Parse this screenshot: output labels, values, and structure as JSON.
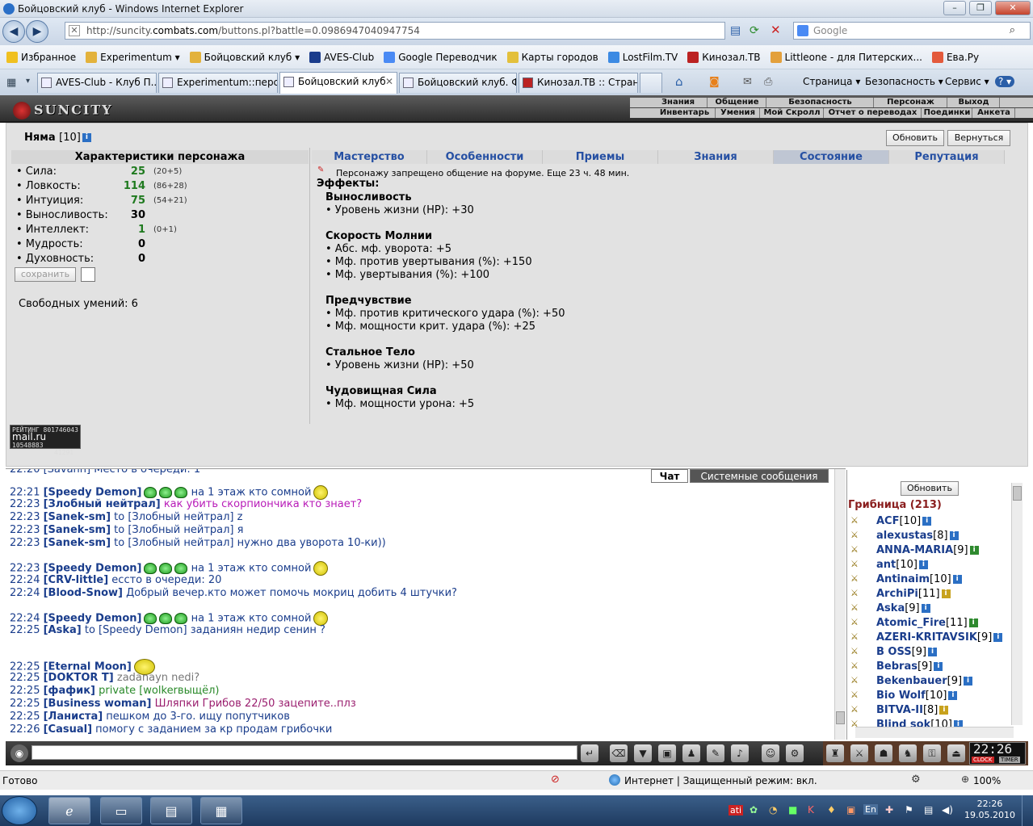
{
  "window": {
    "title": "Бойцовский клуб - Windows Internet Explorer",
    "min": "–",
    "max": "❐",
    "close": "✕"
  },
  "address": {
    "url_pre": "http://suncity.",
    "url_host": "combats.com",
    "url_post": "/buttons.pl?battle=0.0986947040947754",
    "search_placeholder": "Google"
  },
  "favorites": {
    "label": "Избранное",
    "items": [
      {
        "label": "Experimentum ▾",
        "color": "#e3b23c"
      },
      {
        "label": "Бойцовский клуб ▾",
        "color": "#e3b23c"
      },
      {
        "label": "AVES-Club",
        "color": "#1b3d8c"
      },
      {
        "label": "Google Переводчик",
        "color": "#4a8af4"
      },
      {
        "label": "Карты городов",
        "color": "#e3c03c"
      },
      {
        "label": "LostFilm.TV",
        "color": "#3c8ae3"
      },
      {
        "label": "Кинозал.ТВ",
        "color": "#b22"
      },
      {
        "label": "Littleone - для Питерских...",
        "color": "#e3a03c"
      },
      {
        "label": "Ева.Ру",
        "color": "#e35a3c"
      }
    ]
  },
  "tabs": [
    {
      "label": "AVES-Club - Клуб П..."
    },
    {
      "label": "Experimentum::перс..."
    },
    {
      "label": "Бойцовский клуб"
    },
    {
      "label": "Бойцовский клуб. Ф..."
    },
    {
      "label": "Кинозал.ТВ :: Стран..."
    }
  ],
  "tab_close": "✕",
  "toolbar": {
    "page": "Страница ▾",
    "security": "Безопасность ▾",
    "service": "Сервис ▾",
    "help": "? ▾"
  },
  "game": {
    "logo": "SUNCITY",
    "menu_top": [
      "Знания",
      "Общение",
      "Безопасность",
      "Персонаж",
      "Выход"
    ],
    "menu_bottom": [
      "Инвентарь",
      "Умения",
      "Мой Скролл",
      "Отчет о переводах",
      "Поединки",
      "Анкета"
    ],
    "char_name": "Няма",
    "char_level": "[10]",
    "info": "i",
    "refresh": "Обновить",
    "back": "Вернуться",
    "stats_title": "Характеристики персонажа",
    "stats": [
      {
        "name": "• Сила:",
        "value": "25",
        "extra": "(20+5)",
        "color": "#1f7a1f"
      },
      {
        "name": "• Ловкость:",
        "value": "114",
        "extra": "(86+28)",
        "color": "#1f7a1f"
      },
      {
        "name": "• Интуиция:",
        "value": "75",
        "extra": "(54+21)",
        "color": "#1f7a1f"
      },
      {
        "name": "• Выносливость:",
        "value": "30",
        "extra": "",
        "color": "#000000"
      },
      {
        "name": "• Интеллект:",
        "value": "1",
        "extra": "(0+1)",
        "color": "#1f7a1f"
      },
      {
        "name": "• Мудрость:",
        "value": "0",
        "extra": "",
        "color": "#000000"
      },
      {
        "name": "• Духовность:",
        "value": "0",
        "extra": "",
        "color": "#000000"
      }
    ],
    "save": "сохранить",
    "free_skills": "Свободных умений: 6",
    "counter": {
      "a": "РЕЙТИНГ",
      "b": "801746043",
      "c": "mail.ru",
      "d": "10548883",
      "e": "41291"
    },
    "right_tabs": [
      {
        "label": "Мастерство",
        "selected": false
      },
      {
        "label": "Особенности",
        "selected": false
      },
      {
        "label": "Приемы",
        "selected": false
      },
      {
        "label": "Знания",
        "selected": false
      },
      {
        "label": "Состояние",
        "selected": true
      },
      {
        "label": "Репутация",
        "selected": false
      }
    ],
    "ban": "Персонажу запрещено общение на форуме. Еще 23 ч. 48 мин.",
    "effects_title": "Эффекты:",
    "effects": [
      {
        "title": "Выносливость",
        "lines": [
          "• Уровень жизни (HP): +30"
        ]
      },
      {
        "title": "Скорость Молнии",
        "lines": [
          "• Абс. мф. уворота: +5",
          "• Мф. против увертывания (%): +150",
          "• Мф. увертывания (%): +100"
        ]
      },
      {
        "title": "Предчувствие",
        "lines": [
          "• Мф. против критического удара (%): +50",
          "• Мф. мощности крит. удара (%): +25"
        ]
      },
      {
        "title": "Стальное Тело",
        "lines": [
          "• Уровень жизни (HP): +50"
        ]
      },
      {
        "title": "Чудовищная Сила",
        "lines": [
          "• Мф. мощности урона: +5"
        ]
      }
    ]
  },
  "chat": {
    "tabs": [
      "Чат",
      "Системные сообщения"
    ],
    "first": "22:20 [Savann] Место в очереди: 1",
    "lines": [
      {
        "time": "22:21",
        "name": "[Speedy Demon]",
        "text": " на 1 этаж кто сомной",
        "cls": "",
        "smiles": true
      },
      {
        "time": "22:23",
        "name": "[Злобный нейтрал]",
        "text": " как убить скорпиончика кто знает?",
        "cls": "m",
        "smiles": false
      },
      {
        "time": "22:23",
        "name": "[Sanek-sm]",
        "text": " to [Злобный нейтрал] z",
        "cls": "",
        "smiles": false
      },
      {
        "time": "22:23",
        "name": "[Sanek-sm]",
        "text": " to [Злобный нейтрал] я",
        "cls": "",
        "smiles": false
      },
      {
        "time": "22:23",
        "name": "[Sanek-sm]",
        "text": " to [Злобный нейтрал] нужно два уворота 10-ки))",
        "cls": "",
        "smiles": false
      },
      {
        "time": "22:23",
        "name": "[Speedy Demon]",
        "text": " на 1 этаж кто сомной",
        "cls": "",
        "smiles": true
      },
      {
        "time": "22:24",
        "name": "[CRV-little]",
        "text": " ессто в очереди: 20",
        "cls": "",
        "smiles": false
      },
      {
        "time": "22:24",
        "name": "[Blood-Snow]",
        "text": " Добрый вечер.кто может помочь мокриц добить 4 штучки?",
        "cls": "",
        "smiles": false
      },
      {
        "time": "22:24",
        "name": "[Speedy Demon]",
        "text": " на 1 этаж кто сомной",
        "cls": "",
        "smiles": true
      },
      {
        "time": "22:25",
        "name": "[Aska]",
        "text": " to [Speedy Demon] заданиян недир сенин ?",
        "cls": "",
        "smiles": false
      },
      {
        "time": "22:25",
        "name": "[Eternal Moon]",
        "text": "",
        "cls": "",
        "smiles": false
      },
      {
        "time": "22:25",
        "name": "[DOKTOR T]",
        "text": " zadanayn nedi?",
        "cls": "c",
        "smiles": false
      },
      {
        "time": "22:25",
        "name": "[фафик]",
        "text": " private [wolkerвыщёл)",
        "cls": "g",
        "smiles": false
      },
      {
        "time": "22:25",
        "name": "[Business woman]",
        "text": " Шляпки Грибов 22/50 зацепите..плз",
        "cls": "p",
        "smiles": false
      },
      {
        "time": "22:25",
        "name": "[Ланиста]",
        "text": " пешком до 3-го. ищу попутчиков",
        "cls": "",
        "smiles": false
      },
      {
        "time": "22:26",
        "name": "[Casual]",
        "text": " помогу с заданием за кр продам грибочки",
        "cls": "",
        "smiles": false
      }
    ]
  },
  "users": {
    "refresh": "Обновить",
    "room": "Грибница (213)",
    "list": [
      {
        "name": "ACF",
        "lvl": "[10]"
      },
      {
        "name": "alexustas",
        "lvl": "[8]"
      },
      {
        "name": "ANNA-MARIA",
        "lvl": "[9]"
      },
      {
        "name": "ant",
        "lvl": "[10]"
      },
      {
        "name": "Antinaim",
        "lvl": "[10]"
      },
      {
        "name": "ArchiPi",
        "lvl": "[11]"
      },
      {
        "name": "Aska",
        "lvl": "[9]"
      },
      {
        "name": "Atomic_Fire",
        "lvl": "[11]"
      },
      {
        "name": "AZERI-KRITAVSIK",
        "lvl": "[9]"
      },
      {
        "name": "B OSS",
        "lvl": "[9]"
      },
      {
        "name": "Bebras",
        "lvl": "[9]"
      },
      {
        "name": "Bekenbauer",
        "lvl": "[9]"
      },
      {
        "name": "Bio Wolf",
        "lvl": "[10]"
      },
      {
        "name": "BITVA-II",
        "lvl": "[8]"
      },
      {
        "name": "Blind sok",
        "lvl": "[10]"
      }
    ]
  },
  "bottom": {
    "clock": "22:26",
    "clock_sub": "CLOCK",
    "timer": "TIMER"
  },
  "statusbar": {
    "ready": "Готово",
    "zone": "Интернет | Защищенный режим: вкл.",
    "zoom": "100%"
  },
  "taskbar": {
    "time": "22:26",
    "date": "19.05.2010",
    "lang": "En"
  }
}
